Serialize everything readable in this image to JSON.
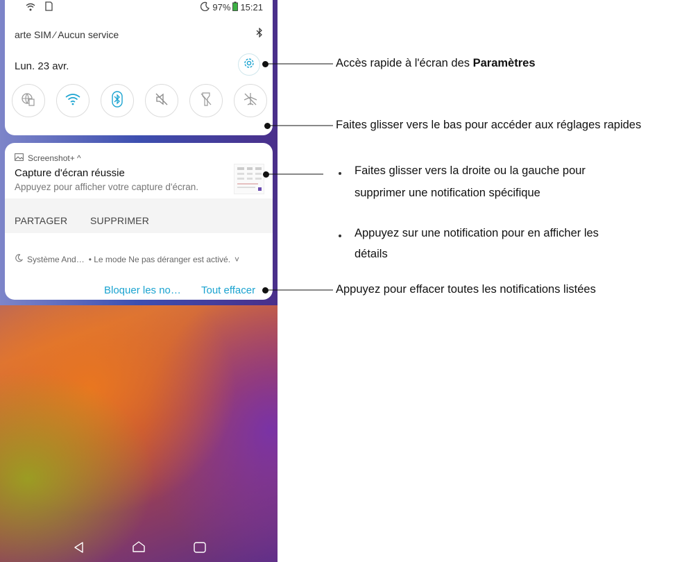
{
  "status_bar": {
    "battery": "97%",
    "time": "15:21"
  },
  "quick_settings": {
    "carrier": "arte SIM ⁄ Aucun service",
    "date": "Lun. 23 avr.",
    "tiles": [
      {
        "icon": "mobile-data-icon"
      },
      {
        "icon": "wifi-icon"
      },
      {
        "icon": "bluetooth-icon"
      },
      {
        "icon": "sound-off-icon"
      },
      {
        "icon": "flashlight-off-icon"
      },
      {
        "icon": "airplane-mode-off-icon"
      }
    ],
    "accent": "#1aa3d0"
  },
  "notification": {
    "app": "Screenshot+ ^",
    "title": "Capture d'écran réussie",
    "text": "Appuyez pour afficher votre capture d'écran.",
    "actions": {
      "share": "PARTAGER",
      "delete": "SUPPRIMER"
    }
  },
  "system_notification": {
    "app": "Système And…",
    "text": "• Le mode Ne pas déranger est activé.",
    "chevron": "˅"
  },
  "footer": {
    "block": "Bloquer les no…",
    "clear_all": "Tout effacer"
  },
  "callouts": {
    "settings_prefix": "Accès rapide à l'écran des ",
    "settings_bold": "Paramètres",
    "swipe_down": "Faites glisser vers le bas pour accéder aux réglages rapides",
    "swipe_side_1": "Faites glisser vers la droite ou la gauche pour",
    "swipe_side_2": "supprimer une notification spécifique",
    "tap_1": "Appuyez sur une notification pour en afficher les",
    "tap_2": "détails",
    "clear": "Appuyez pour effacer toutes les notifications listées"
  }
}
